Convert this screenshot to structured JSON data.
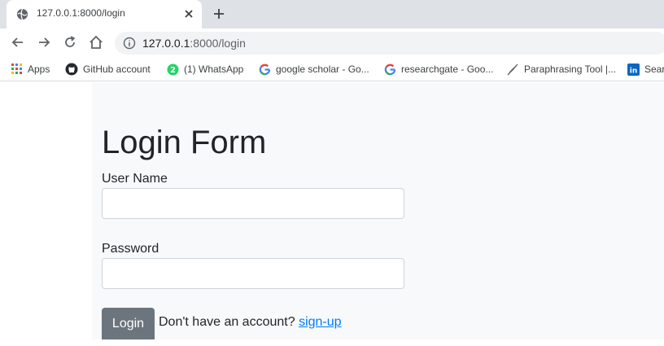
{
  "tab": {
    "title": "127.0.0.1:8000/login",
    "favicon": "globe-icon"
  },
  "address_bar": {
    "host": "127.0.0.1",
    "path": ":8000/login"
  },
  "bookmarks": [
    {
      "label": "Apps",
      "icon": "apps-grid-icon"
    },
    {
      "label": "GitHub account",
      "icon": "github-icon"
    },
    {
      "label": "(1) WhatsApp",
      "icon": "whatsapp-icon"
    },
    {
      "label": "google scholar - Go...",
      "icon": "google-icon"
    },
    {
      "label": "researchgate - Goo...",
      "icon": "google-icon"
    },
    {
      "label": "Paraphrasing Tool |...",
      "icon": "feather-icon"
    },
    {
      "label": "Sear",
      "icon": "linkedin-icon"
    }
  ],
  "form": {
    "title": "Login Form",
    "username_label": "User Name",
    "password_label": "Password",
    "login_button": "Login",
    "signup_prompt": "Don't have an account?",
    "signup_link": "sign-up"
  },
  "colors": {
    "container_bg": "#f8f9fa",
    "button_bg": "#6c757d",
    "link": "#007bff"
  }
}
